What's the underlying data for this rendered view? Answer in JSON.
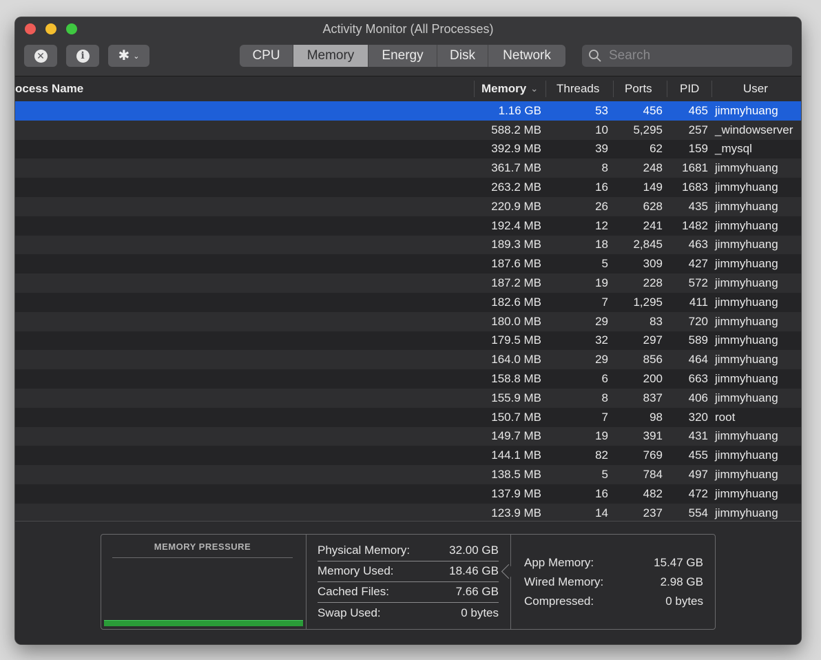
{
  "window": {
    "title": "Activity Monitor (All Processes)"
  },
  "toolbar": {
    "stop_icon": "xmark-circle-icon",
    "info_icon": "info-circle-icon",
    "action_icon": "gear-icon",
    "tabs": [
      "CPU",
      "Memory",
      "Energy",
      "Disk",
      "Network"
    ],
    "active_tab": "Memory",
    "search_placeholder": "Search"
  },
  "columns": {
    "process_name": "ocess Name",
    "memory": "Memory",
    "threads": "Threads",
    "ports": "Ports",
    "pid": "PID",
    "user": "User"
  },
  "rows": [
    {
      "memory": "1.16 GB",
      "threads": "53",
      "ports": "456",
      "pid": "465",
      "user": "jimmyhuang"
    },
    {
      "memory": "588.2 MB",
      "threads": "10",
      "ports": "5,295",
      "pid": "257",
      "user": "_windowserver"
    },
    {
      "memory": "392.9 MB",
      "threads": "39",
      "ports": "62",
      "pid": "159",
      "user": "_mysql"
    },
    {
      "memory": "361.7 MB",
      "threads": "8",
      "ports": "248",
      "pid": "1681",
      "user": "jimmyhuang"
    },
    {
      "memory": "263.2 MB",
      "threads": "16",
      "ports": "149",
      "pid": "1683",
      "user": "jimmyhuang"
    },
    {
      "memory": "220.9 MB",
      "threads": "26",
      "ports": "628",
      "pid": "435",
      "user": "jimmyhuang"
    },
    {
      "memory": "192.4 MB",
      "threads": "12",
      "ports": "241",
      "pid": "1482",
      "user": "jimmyhuang"
    },
    {
      "memory": "189.3 MB",
      "threads": "18",
      "ports": "2,845",
      "pid": "463",
      "user": "jimmyhuang"
    },
    {
      "memory": "187.6 MB",
      "threads": "5",
      "ports": "309",
      "pid": "427",
      "user": "jimmyhuang"
    },
    {
      "memory": "187.2 MB",
      "threads": "19",
      "ports": "228",
      "pid": "572",
      "user": "jimmyhuang"
    },
    {
      "memory": "182.6 MB",
      "threads": "7",
      "ports": "1,295",
      "pid": "411",
      "user": "jimmyhuang"
    },
    {
      "memory": "180.0 MB",
      "threads": "29",
      "ports": "83",
      "pid": "720",
      "user": "jimmyhuang"
    },
    {
      "memory": "179.5 MB",
      "threads": "32",
      "ports": "297",
      "pid": "589",
      "user": "jimmyhuang"
    },
    {
      "memory": "164.0 MB",
      "threads": "29",
      "ports": "856",
      "pid": "464",
      "user": "jimmyhuang"
    },
    {
      "memory": "158.8 MB",
      "threads": "6",
      "ports": "200",
      "pid": "663",
      "user": "jimmyhuang"
    },
    {
      "memory": "155.9 MB",
      "threads": "8",
      "ports": "837",
      "pid": "406",
      "user": "jimmyhuang"
    },
    {
      "memory": "150.7 MB",
      "threads": "7",
      "ports": "98",
      "pid": "320",
      "user": "root"
    },
    {
      "memory": "149.7 MB",
      "threads": "19",
      "ports": "391",
      "pid": "431",
      "user": "jimmyhuang"
    },
    {
      "memory": "144.1 MB",
      "threads": "82",
      "ports": "769",
      "pid": "455",
      "user": "jimmyhuang"
    },
    {
      "memory": "138.5 MB",
      "threads": "5",
      "ports": "784",
      "pid": "497",
      "user": "jimmyhuang"
    },
    {
      "memory": "137.9 MB",
      "threads": "16",
      "ports": "482",
      "pid": "472",
      "user": "jimmyhuang"
    },
    {
      "memory": "123.9 MB",
      "threads": "14",
      "ports": "237",
      "pid": "554",
      "user": "jimmyhuang"
    }
  ],
  "summary": {
    "pressure_title": "MEMORY PRESSURE",
    "physical_memory_label": "Physical Memory:",
    "physical_memory_value": "32.00 GB",
    "memory_used_label": "Memory Used:",
    "memory_used_value": "18.46 GB",
    "cached_files_label": "Cached Files:",
    "cached_files_value": "7.66 GB",
    "swap_used_label": "Swap Used:",
    "swap_used_value": "0 bytes",
    "app_memory_label": "App Memory:",
    "app_memory_value": "15.47 GB",
    "wired_memory_label": "Wired Memory:",
    "wired_memory_value": "2.98 GB",
    "compressed_label": "Compressed:",
    "compressed_value": "0 bytes"
  },
  "colors": {
    "selection": "#1e5fd8",
    "pressure_green": "#2a9b38",
    "close": "#ee5c57",
    "minimize": "#f4be2f",
    "maximize": "#3fc841"
  }
}
